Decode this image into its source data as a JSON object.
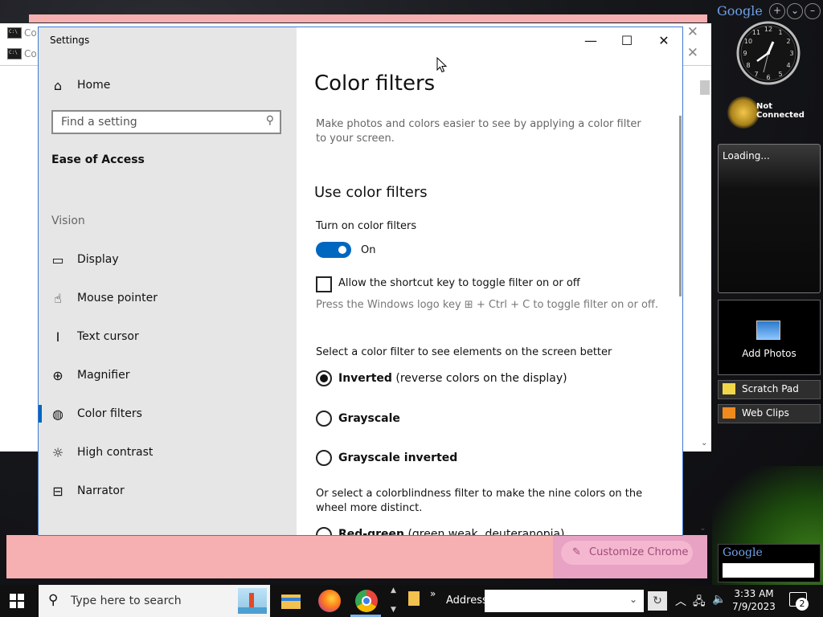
{
  "background": {
    "cmd_window_title_1": "Co",
    "cmd_window_title_2": "Co",
    "chrome_button": "Customize Chrome"
  },
  "gadgets": {
    "google_logo": "Google",
    "not_connected": "Not Connected",
    "loading": "Loading...",
    "add_photos": "Add Photos",
    "scratch_pad": "Scratch Pad",
    "web_clips": "Web Clips",
    "google_search_logo": "Google"
  },
  "settings": {
    "window_title": "Settings",
    "home": "Home",
    "search_placeholder": "Find a setting",
    "category": "Ease of Access",
    "section": "Vision",
    "nav": [
      {
        "label": "Display",
        "icon": "display-icon"
      },
      {
        "label": "Mouse pointer",
        "icon": "mouse-pointer-icon"
      },
      {
        "label": "Text cursor",
        "icon": "text-cursor-icon"
      },
      {
        "label": "Magnifier",
        "icon": "magnifier-icon"
      },
      {
        "label": "Color filters",
        "icon": "palette-icon",
        "selected": true
      },
      {
        "label": "High contrast",
        "icon": "high-contrast-icon"
      },
      {
        "label": "Narrator",
        "icon": "narrator-icon"
      }
    ],
    "page_title": "Color filters",
    "description": "Make photos and colors easier to see by applying a color filter to your screen.",
    "use_heading": "Use color filters",
    "toggle_label": "Turn on color filters",
    "toggle_state": "On",
    "shortcut_label": "Allow the shortcut key to toggle filter on or off",
    "shortcut_hint_pre": "Press the Windows logo key",
    "shortcut_hint_post": "+ Ctrl + C to toggle filter on or off.",
    "select_label": "Select a color filter to see elements on the screen better",
    "filters": [
      {
        "name": "Inverted",
        "desc": "(reverse colors on the display)",
        "checked": true
      },
      {
        "name": "Grayscale",
        "desc": "",
        "checked": false
      },
      {
        "name": "Grayscale inverted",
        "desc": "",
        "checked": false
      }
    ],
    "colorblind_label": "Or select a colorblindness filter to make the nine colors on the wheel more distinct.",
    "partial_filter_name": "Red-green",
    "partial_filter_desc": "(green weak, deuteranopia)"
  },
  "taskbar": {
    "search_placeholder": "Type here to search",
    "address_label": "Address",
    "chevron": "»",
    "time": "3:33 AM",
    "date": "7/9/2023",
    "notifications": "2"
  }
}
